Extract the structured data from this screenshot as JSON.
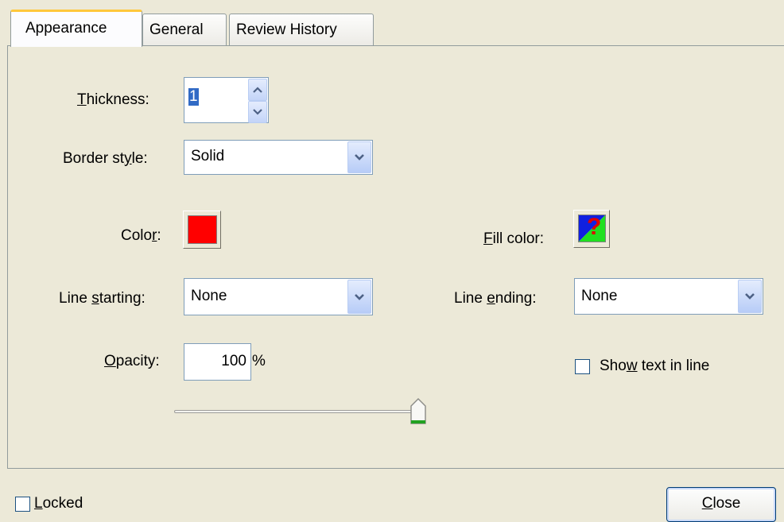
{
  "tabs": [
    "Appearance",
    "General",
    "Review History"
  ],
  "thickness": {
    "label_pre": "",
    "label_u": "T",
    "label_post": "hickness:",
    "value": "1"
  },
  "border_style": {
    "label_pre": "Border st",
    "label_u": "y",
    "label_post": "le:",
    "value": "Solid"
  },
  "color": {
    "label_pre": "Colo",
    "label_u": "r",
    "label_post": ":",
    "value": "#ff0000"
  },
  "fill_color": {
    "label_pre": "",
    "label_u": "F",
    "label_post": "ill color:",
    "glyph": "?"
  },
  "line_starting": {
    "label_pre": "Line ",
    "label_u": "s",
    "label_post": "tarting:",
    "value": "None"
  },
  "line_ending": {
    "label_pre": "Line ",
    "label_u": "e",
    "label_post": "nding:",
    "value": "None"
  },
  "opacity": {
    "label_pre": "",
    "label_u": "O",
    "label_post": "pacity:",
    "value": "100",
    "unit": "%",
    "level": 1.0
  },
  "show_text": {
    "label_pre": "Sho",
    "label_u": "w",
    "label_post": " text in line",
    "checked": false
  },
  "locked": {
    "label_pre": "",
    "label_u": "L",
    "label_post": "ocked",
    "checked": false
  },
  "close": {
    "label_pre": "",
    "label_u": "C",
    "label_post": "lose"
  },
  "colors": {
    "accent_tab": "#ffc83c",
    "field_border": "#7f9db9",
    "background": "#ece9d8"
  }
}
